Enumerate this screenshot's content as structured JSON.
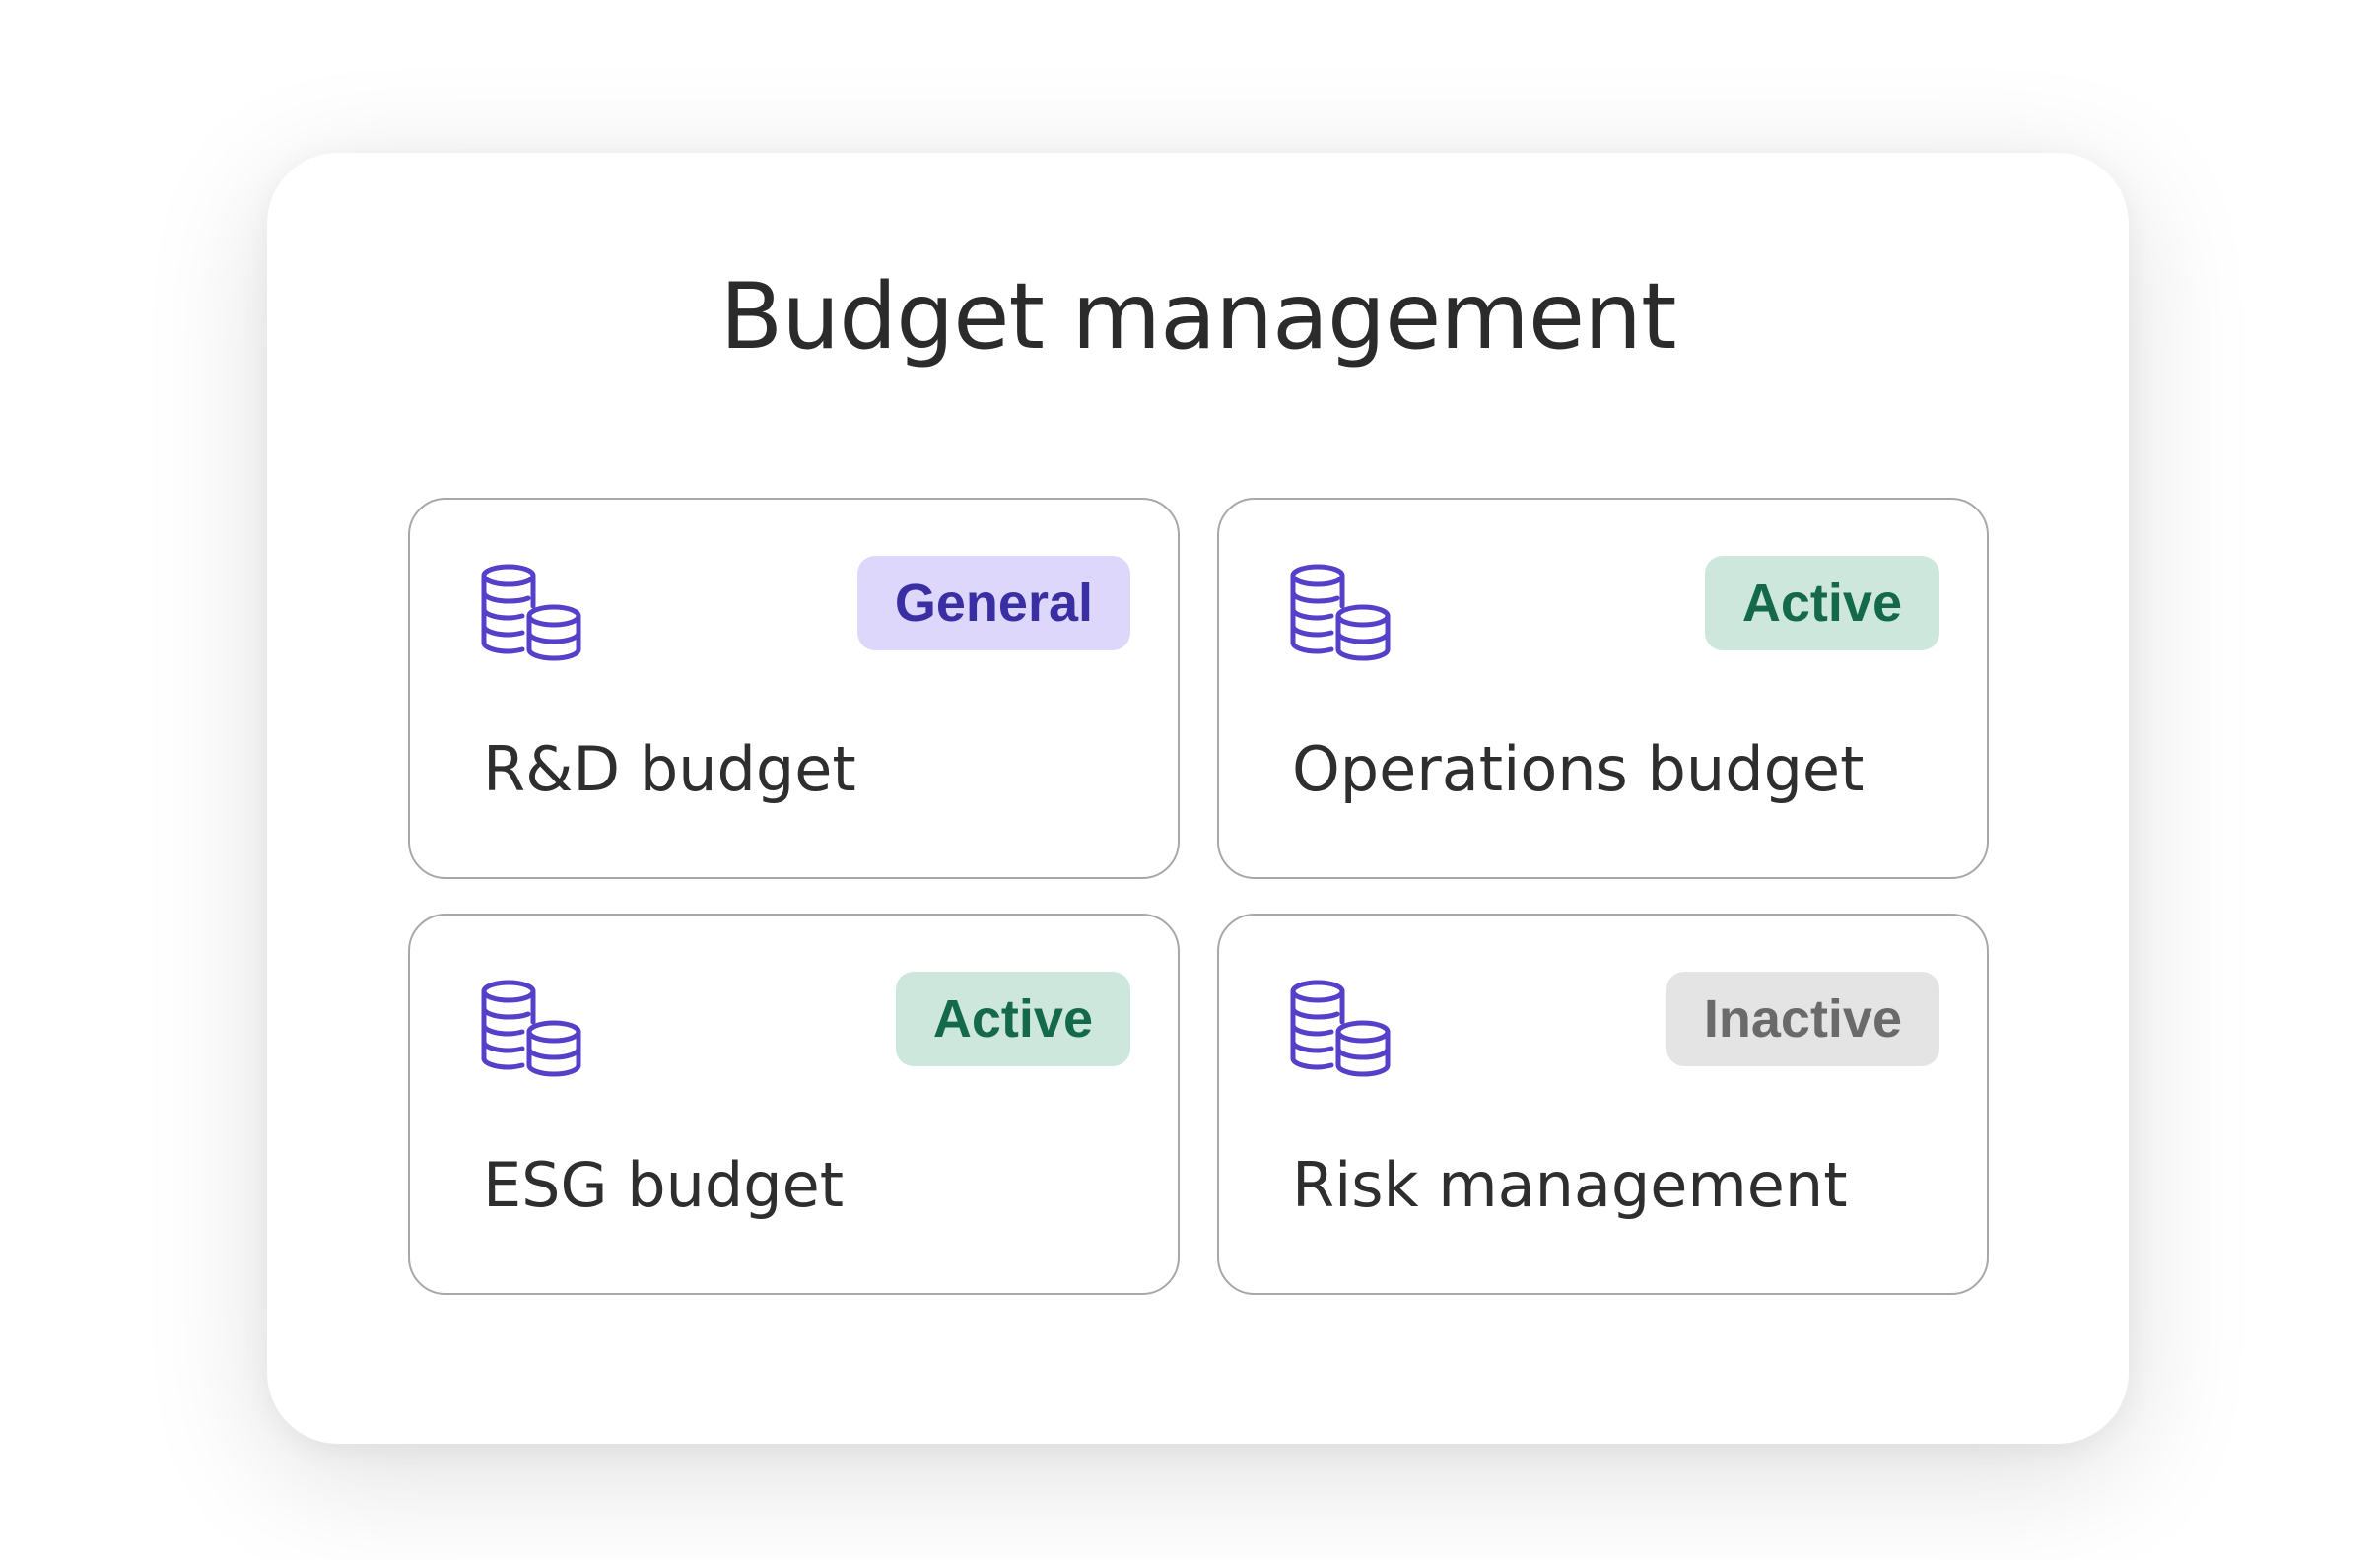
{
  "title": "Budget management",
  "colors": {
    "icon": "#5540c9",
    "general_badge_bg": "#dcd7fb",
    "general_badge_text": "#3a2ea3",
    "active_badge_bg": "#cde7dd",
    "active_badge_text": "#13694a",
    "inactive_badge_bg": "#e4e4e4",
    "inactive_badge_text": "#6a6a6a"
  },
  "cards": [
    {
      "label": "R&D budget",
      "badge": "General",
      "status": "general",
      "icon": "coins-stack-icon"
    },
    {
      "label": "Operations budget",
      "badge": "Active",
      "status": "active",
      "icon": "coins-stack-icon"
    },
    {
      "label": "ESG budget",
      "badge": "Active",
      "status": "active",
      "icon": "coins-stack-icon"
    },
    {
      "label": "Risk management",
      "badge": "Inactive",
      "status": "inactive",
      "icon": "coins-stack-icon"
    }
  ]
}
